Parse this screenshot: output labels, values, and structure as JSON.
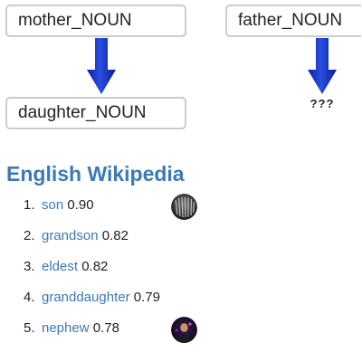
{
  "analogy": {
    "term_a": "mother_NOUN",
    "term_b": "father_NOUN",
    "term_c": "daughter_NOUN",
    "unknown": "???"
  },
  "source": {
    "title": "English Wikipedia"
  },
  "results": [
    {
      "rank": "1.",
      "word": "son",
      "score": "0.90",
      "thumbnail": "speaker-grille-image"
    },
    {
      "rank": "2.",
      "word": "grandson",
      "score": "0.82"
    },
    {
      "rank": "3.",
      "word": "eldest",
      "score": "0.82"
    },
    {
      "rank": "4.",
      "word": "granddaughter",
      "score": "0.79"
    },
    {
      "rank": "5.",
      "word": "nephew",
      "score": "0.78",
      "thumbnail": "portrait-image"
    }
  ],
  "colors": {
    "arrow": "#1736c9",
    "link": "#3a7ab8",
    "box_border": "#cccccc"
  }
}
